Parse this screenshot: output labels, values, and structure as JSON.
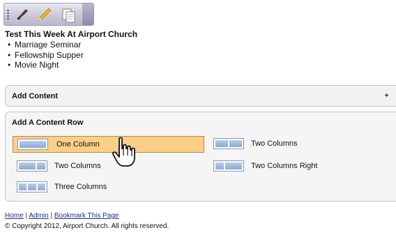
{
  "toolbar": {
    "tools": [
      {
        "name": "brush-icon"
      },
      {
        "name": "pencil-icon"
      },
      {
        "name": "page-icon"
      }
    ]
  },
  "content": {
    "title": "Test This Week At Airport Church",
    "items": [
      "Marriage Seminar",
      "Fellowship Supper",
      "Movie Night"
    ]
  },
  "add_content_panel": {
    "header": "Add Content",
    "expand_symbol": "+"
  },
  "add_row_panel": {
    "header": "Add A Content Row",
    "options": {
      "one_column": "One Column",
      "two_columns_left": "Two Columns",
      "three_columns": "Three Columns",
      "two_columns": "Two Columns",
      "two_columns_right": "Two Columns Right"
    },
    "highlight_color": "#fbcf87"
  },
  "footer": {
    "links": [
      "Home",
      "Admin",
      "Bookmark This Page"
    ],
    "separator": "|",
    "copyright": "© Copyright 2012, Airport Church. All rights reserved."
  }
}
